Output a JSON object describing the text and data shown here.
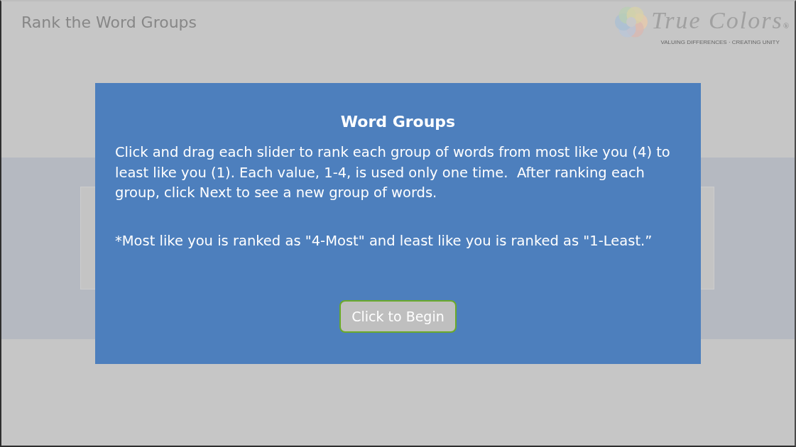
{
  "page": {
    "title": "Rank the Word Groups"
  },
  "logo": {
    "name": "True Colors",
    "mark": "®",
    "tagline": "VALUING DIFFERENCES · CREATING UNITY"
  },
  "dialog": {
    "title": "Word Groups",
    "paragraphs": [
      "Click and drag each slider to rank each group of words from most like you (4) to least like you (1). Each value, 1-4, is used only one time.  After ranking each group, click Next to see a new group of words.",
      "*Most like you is ranked as \"4-Most\" and least like you is ranked as \"1-Least.”"
    ],
    "button": "Click to Begin"
  }
}
